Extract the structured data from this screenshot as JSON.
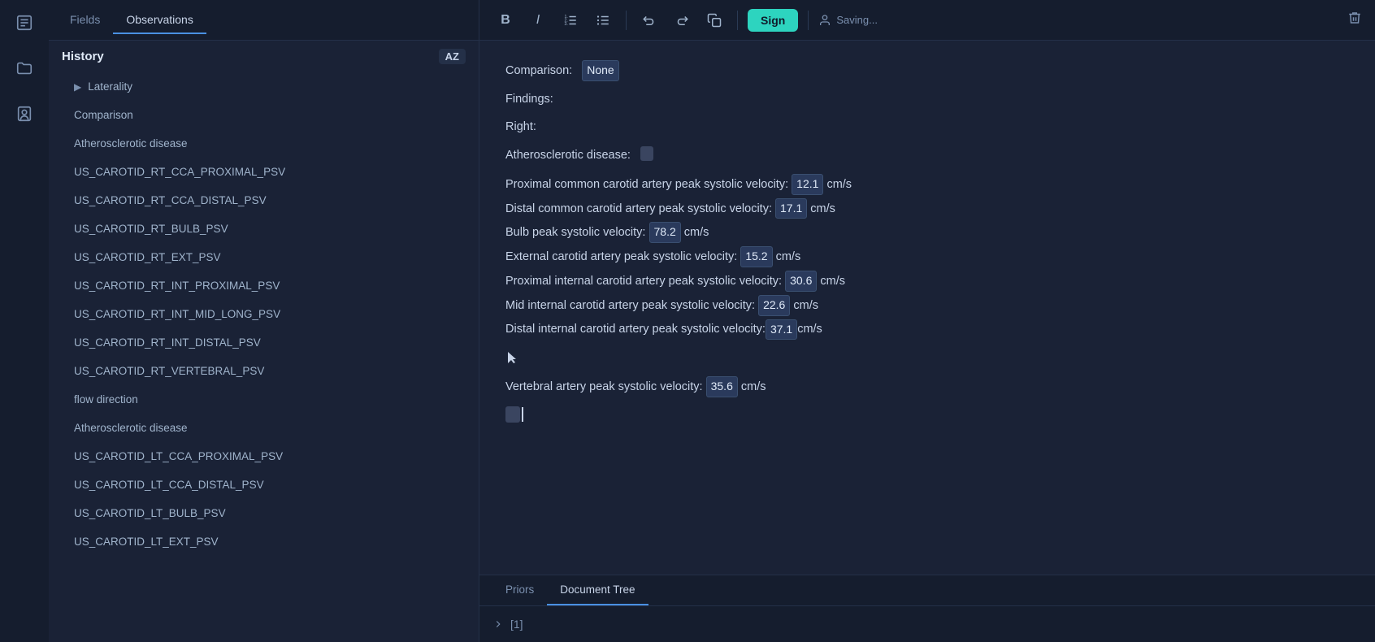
{
  "sidebar_icons": {
    "document_icon": "📄",
    "folder_icon": "📁",
    "badge_icon": "🔖"
  },
  "tabs": {
    "fields": "Fields",
    "observations": "Observations"
  },
  "list": {
    "az_label": "AZ",
    "history_label": "History",
    "laterality_label": "Laterality",
    "comparison_label": "Comparison",
    "atherosclerotic_disease_label": "Atherosclerotic disease",
    "items": [
      "US_CAROTID_RT_CCA_PROXIMAL_PSV",
      "US_CAROTID_RT_CCA_DISTAL_PSV",
      "US_CAROTID_RT_BULB_PSV",
      "US_CAROTID_RT_EXT_PSV",
      "US_CAROTID_RT_INT_PROXIMAL_PSV",
      "US_CAROTID_RT_INT_MID_LONG_PSV",
      "US_CAROTID_RT_INT_DISTAL_PSV",
      "US_CAROTID_RT_VERTEBRAL_PSV"
    ],
    "flow_direction_label": "flow direction",
    "items2": [
      "Atherosclerotic disease",
      "US_CAROTID_LT_CCA_PROXIMAL_PSV",
      "US_CAROTID_LT_CCA_DISTAL_PSV",
      "US_CAROTID_LT_BULB_PSV",
      "US_CAROTID_LT_EXT_PSV"
    ]
  },
  "toolbar": {
    "bold_label": "B",
    "italic_label": "I",
    "ordered_list_icon": "≡",
    "unordered_list_icon": "☰",
    "undo_icon": "↺",
    "redo_icon": "↻",
    "copy_icon": "⧉",
    "sign_label": "Sign",
    "saving_label": "Saving...",
    "user_icon": "👤",
    "trash_icon": "🗑"
  },
  "editor": {
    "comparison_label": "Comparison:",
    "comparison_value": "None",
    "findings_label": "Findings:",
    "right_label": "Right:",
    "atherosclerotic_label": "Atherosclerotic disease:",
    "lines": [
      {
        "text": "Proximal common carotid artery peak systolic velocity:",
        "value": "12.1",
        "unit": "cm/s"
      },
      {
        "text": "Distal common carotid artery peak systolic velocity:",
        "value": "17.1",
        "unit": "cm/s"
      },
      {
        "text": "Bulb peak systolic velocity:",
        "value": "78.2",
        "unit": "cm/s"
      },
      {
        "text": "External carotid artery peak systolic velocity:",
        "value": "15.2",
        "unit": "cm/s"
      },
      {
        "text": "Proximal internal carotid artery peak systolic velocity:",
        "value": "30.6",
        "unit": "cm/s"
      },
      {
        "text": "Mid internal carotid artery peak systolic velocity:",
        "value": "22.6",
        "unit": "cm/s"
      },
      {
        "text": "Distal internal carotid artery peak systolic velocity:",
        "value": "37.1",
        "unit": "cm/s"
      }
    ],
    "vertebral_line": {
      "text": "Vertebral artery peak systolic velocity:",
      "value": "35.6",
      "unit": "cm/s"
    }
  },
  "bottom_tabs": {
    "priors_label": "Priors",
    "document_tree_label": "Document Tree"
  },
  "tree": {
    "item_label": "[1]"
  }
}
